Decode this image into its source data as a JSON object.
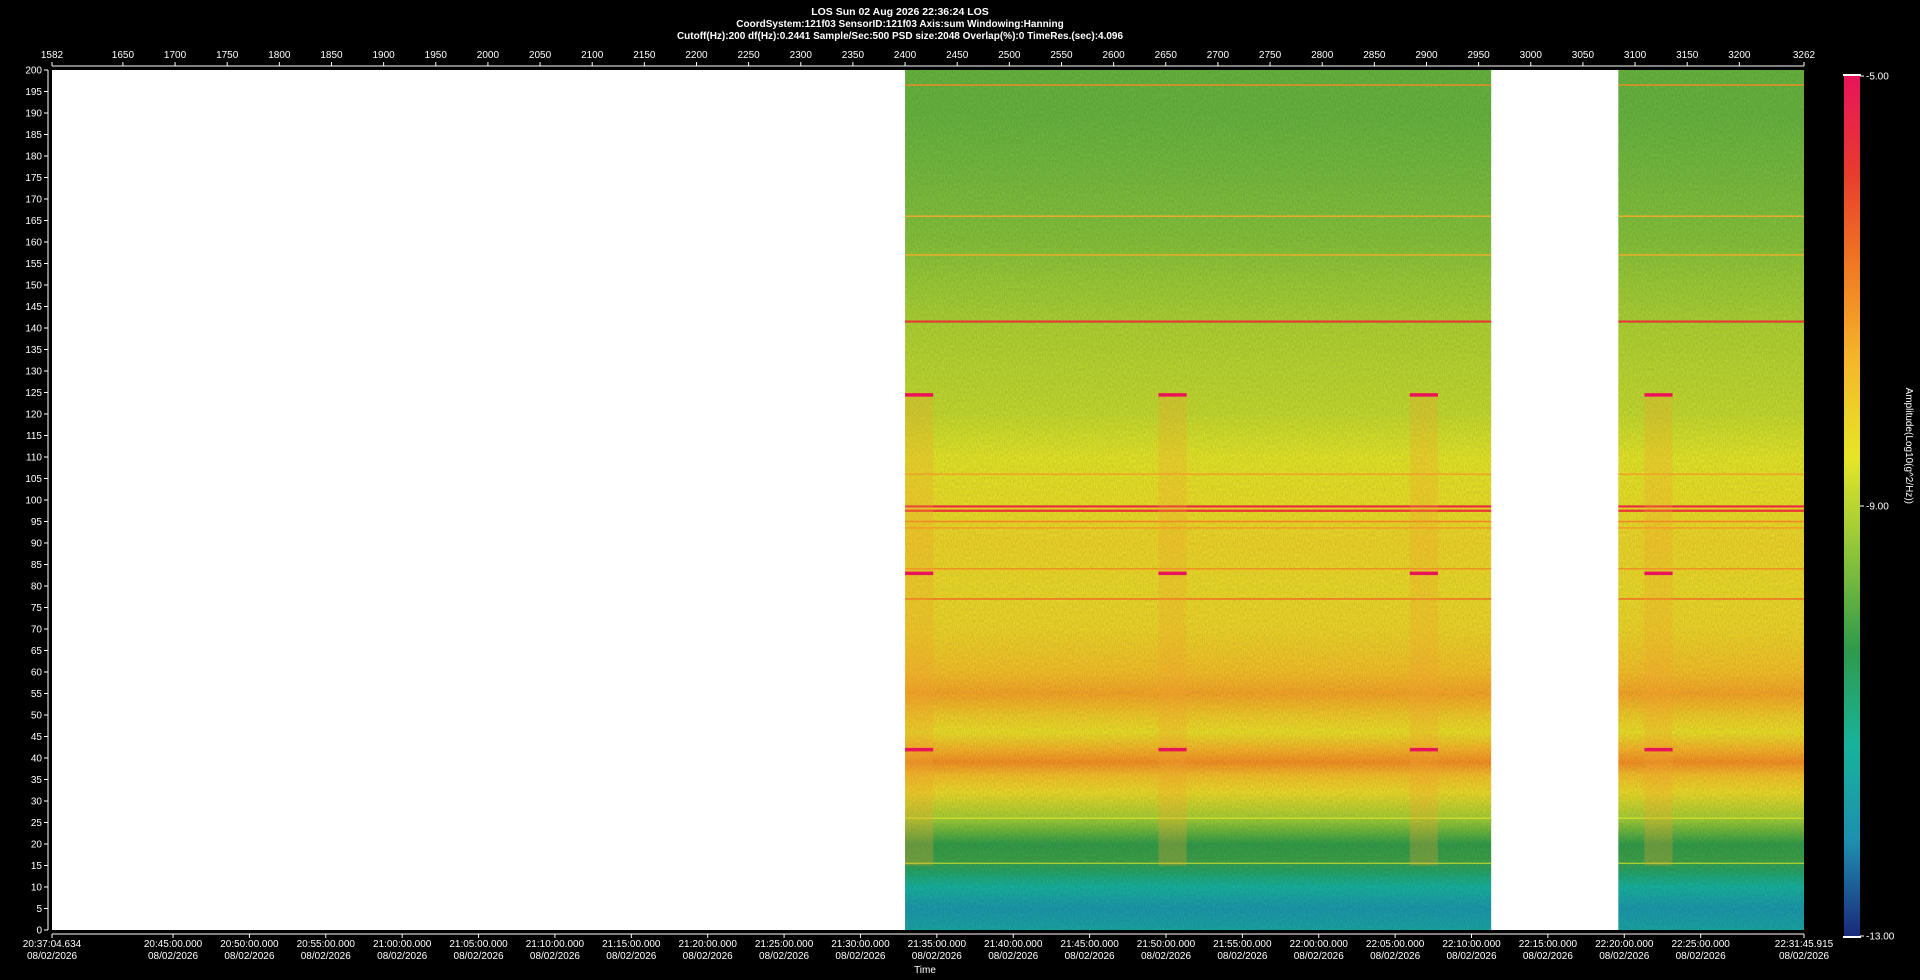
{
  "header": {
    "line1": "LOS  Sun 02 Aug 2026 22:36:24  LOS",
    "line2": "CoordSystem:121f03   SensorID:121f03    Axis:sum    Windowing:Hanning",
    "line3": "Cutoff(Hz):200       df(Hz):0.2441       Sample/Sec:500       PSD size:2048        Overlap(%):0          TimeRes.(sec):4.096"
  },
  "chart_data": {
    "type": "heatmap",
    "title": "LOS  Sun 02 Aug 2026 22:36:24  LOS",
    "xlabel": "Time",
    "ylabel": "",
    "colorbar_label": "Amplitude(Log10(g^2/Hz))",
    "ylim": [
      0,
      200
    ],
    "index_axis_range": [
      1582,
      3262
    ],
    "index_axis_ticks": [
      "1582",
      "1650",
      "1700",
      "1750",
      "1800",
      "1850",
      "1900",
      "1950",
      "2000",
      "2050",
      "2100",
      "2150",
      "2200",
      "2250",
      "2300",
      "2350",
      "2400",
      "2450",
      "2500",
      "2550",
      "2600",
      "2650",
      "2700",
      "2750",
      "2800",
      "2850",
      "2900",
      "2950",
      "3000",
      "3050",
      "3100",
      "3150",
      "3200",
      "3262"
    ],
    "y_ticks": [
      "200",
      "195",
      "190",
      "185",
      "180",
      "175",
      "170",
      "165",
      "160",
      "155",
      "150",
      "145",
      "140",
      "135",
      "130",
      "125",
      "120",
      "115",
      "110",
      "105",
      "100",
      "95",
      "90",
      "85",
      "80",
      "75",
      "70",
      "65",
      "60",
      "55",
      "50",
      "45",
      "40",
      "35",
      "30",
      "25",
      "20",
      "15",
      "10",
      "5",
      "0"
    ],
    "time_ticks": [
      {
        "time": "20:37:04.634",
        "date": "08/02/2026"
      },
      {
        "time": "20:45:00.000",
        "date": "08/02/2026"
      },
      {
        "time": "20:50:00.000",
        "date": "08/02/2026"
      },
      {
        "time": "20:55:00.000",
        "date": "08/02/2026"
      },
      {
        "time": "21:00:00.000",
        "date": "08/02/2026"
      },
      {
        "time": "21:05:00.000",
        "date": "08/02/2026"
      },
      {
        "time": "21:10:00.000",
        "date": "08/02/2026"
      },
      {
        "time": "21:15:00.000",
        "date": "08/02/2026"
      },
      {
        "time": "21:20:00.000",
        "date": "08/02/2026"
      },
      {
        "time": "21:25:00.000",
        "date": "08/02/2026"
      },
      {
        "time": "21:30:00.000",
        "date": "08/02/2026"
      },
      {
        "time": "21:35:00.000",
        "date": "08/02/2026"
      },
      {
        "time": "21:40:00.000",
        "date": "08/02/2026"
      },
      {
        "time": "21:45:00.000",
        "date": "08/02/2026"
      },
      {
        "time": "21:50:00.000",
        "date": "08/02/2026"
      },
      {
        "time": "21:55:00.000",
        "date": "08/02/2026"
      },
      {
        "time": "22:00:00.000",
        "date": "08/02/2026"
      },
      {
        "time": "22:05:00.000",
        "date": "08/02/2026"
      },
      {
        "time": "22:10:00.000",
        "date": "08/02/2026"
      },
      {
        "time": "22:15:00.000",
        "date": "08/02/2026"
      },
      {
        "time": "22:20:00.000",
        "date": "08/02/2026"
      },
      {
        "time": "22:25:00.000",
        "date": "08/02/2026"
      },
      {
        "time": "22:31:45.915",
        "date": "08/02/2026"
      }
    ],
    "colorbar": {
      "min": -13,
      "max": -5,
      "ticks": [
        "-5.00",
        "-9.00",
        "-13.00"
      ]
    },
    "colormap": [
      "#1a2a7a",
      "#1e8fb0",
      "#17b39b",
      "#2f9a4a",
      "#8cc43a",
      "#e6e628",
      "#f5b82a",
      "#f07a22",
      "#e83a2e",
      "#e8145a"
    ],
    "data_segments": [
      {
        "start": 2400,
        "end": 2962
      },
      {
        "start": 3084,
        "end": 3262
      }
    ],
    "frequency_bands": [
      {
        "hz": 0,
        "level": -11.6
      },
      {
        "hz": 5,
        "level": -11.9
      },
      {
        "hz": 10,
        "level": -11.3
      },
      {
        "hz": 14,
        "level": -10.6
      },
      {
        "hz": 16,
        "level": -10.2
      },
      {
        "hz": 20,
        "level": -10.3
      },
      {
        "hz": 26,
        "level": -9.2
      },
      {
        "hz": 32,
        "level": -8.3
      },
      {
        "hz": 36,
        "level": -7.8
      },
      {
        "hz": 39,
        "level": -7.1
      },
      {
        "hz": 42,
        "level": -7.6
      },
      {
        "hz": 46,
        "level": -8.4
      },
      {
        "hz": 50,
        "level": -8.0
      },
      {
        "hz": 55,
        "level": -7.4
      },
      {
        "hz": 60,
        "level": -7.8
      },
      {
        "hz": 70,
        "level": -8.2
      },
      {
        "hz": 80,
        "level": -8.3
      },
      {
        "hz": 90,
        "level": -8.2
      },
      {
        "hz": 100,
        "level": -8.4
      },
      {
        "hz": 110,
        "level": -8.6
      },
      {
        "hz": 120,
        "level": -8.9
      },
      {
        "hz": 130,
        "level": -9.0
      },
      {
        "hz": 140,
        "level": -9.1
      },
      {
        "hz": 150,
        "level": -9.3
      },
      {
        "hz": 160,
        "level": -9.5
      },
      {
        "hz": 170,
        "level": -9.6
      },
      {
        "hz": 180,
        "level": -9.7
      },
      {
        "hz": 190,
        "level": -9.8
      },
      {
        "hz": 200,
        "level": -9.8
      }
    ],
    "tonal_lines": [
      {
        "hz": 196.5,
        "level": -7.0
      },
      {
        "hz": 166,
        "level": -7.5
      },
      {
        "hz": 157,
        "level": -7.5
      },
      {
        "hz": 141.5,
        "level": -5.8
      },
      {
        "hz": 106,
        "level": -7.3
      },
      {
        "hz": 98.5,
        "level": -5.5
      },
      {
        "hz": 97.5,
        "level": -5.8
      },
      {
        "hz": 95,
        "level": -6.9
      },
      {
        "hz": 93.5,
        "level": -7.2
      },
      {
        "hz": 84,
        "level": -7.0
      },
      {
        "hz": 77,
        "level": -6.5
      },
      {
        "hz": 26,
        "level": -8.8
      },
      {
        "hz": 15.5,
        "level": -9.2
      }
    ],
    "transient_events": [
      {
        "start": 2400,
        "end": 2427
      },
      {
        "start": 2643,
        "end": 2670
      },
      {
        "start": 2884,
        "end": 2911
      },
      {
        "start": 3109,
        "end": 3136
      }
    ],
    "event_tones_hz": [
      124.5,
      83,
      42
    ]
  }
}
